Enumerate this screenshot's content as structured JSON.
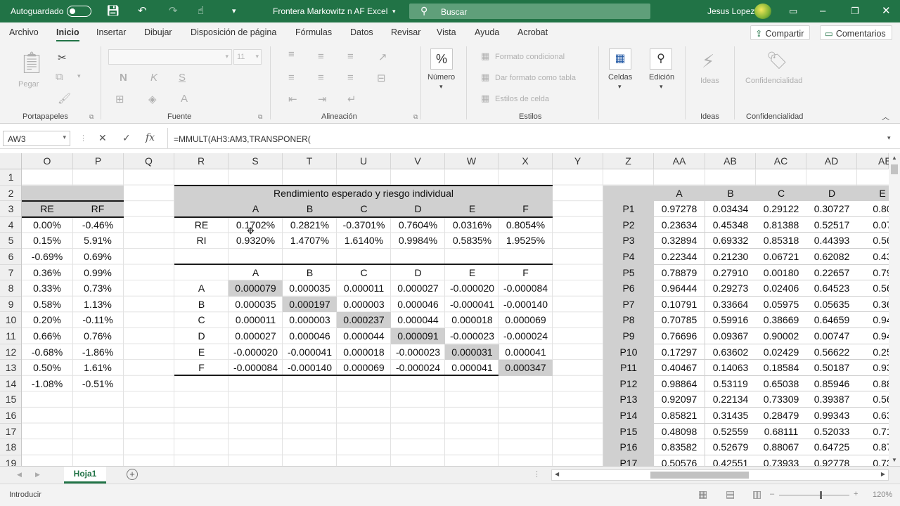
{
  "titlebar": {
    "autosave": "Autoguardado",
    "filename": "Frontera Markowitz n AF Excel",
    "search": "Buscar",
    "user": "Jesus Lopez"
  },
  "menu": {
    "items": [
      "Archivo",
      "Inicio",
      "Insertar",
      "Dibujar",
      "Disposición de página",
      "Fórmulas",
      "Datos",
      "Revisar",
      "Vista",
      "Ayuda",
      "Acrobat"
    ],
    "share": "Compartir",
    "comments": "Comentarios"
  },
  "ribbon": {
    "paste": "Pegar",
    "clipboard": "Portapapeles",
    "font_size": "11",
    "bold": "N",
    "italic": "K",
    "underline": "S",
    "font": "Fuente",
    "alignment": "Alineación",
    "number_sym": "%",
    "number": "Número",
    "cond_format": "Formato condicional",
    "table_format": "Dar formato como tabla",
    "cell_styles": "Estilos de celda",
    "styles": "Estilos",
    "cells": "Celdas",
    "editing": "Edición",
    "ideas": "Ideas",
    "ideas_group": "Ideas",
    "confidentiality": "Confidencialidad",
    "confidentiality_group": "Confidencialidad"
  },
  "formula_bar": {
    "name_box": "AW3",
    "formula": "=MMULT(AH3:AM3,TRANSPONER("
  },
  "columns": [
    "O",
    "P",
    "Q",
    "R",
    "S",
    "T",
    "U",
    "V",
    "W",
    "X",
    "Y",
    "Z",
    "AA",
    "AB",
    "AC",
    "AD",
    "AE"
  ],
  "rows": [
    "1",
    "2",
    "3",
    "4",
    "5",
    "6",
    "7",
    "8",
    "9",
    "10",
    "11",
    "12",
    "13",
    "14",
    "15",
    "16",
    "17",
    "18",
    "19"
  ],
  "left_table": {
    "headers": [
      "RE",
      "RF"
    ],
    "re": [
      "0.00%",
      "0.15%",
      "-0.69%",
      "0.36%",
      "0.33%",
      "0.58%",
      "0.20%",
      "0.66%",
      "-0.68%",
      "0.50%",
      "-1.08%"
    ],
    "rf": [
      "-0.46%",
      "5.91%",
      "0.69%",
      "0.99%",
      "0.73%",
      "1.13%",
      "-0.11%",
      "0.76%",
      "-1.86%",
      "1.61%",
      "-0.51%"
    ]
  },
  "risk_table": {
    "title": "Rendimiento esperado y riesgo individual",
    "assets": [
      "A",
      "B",
      "C",
      "D",
      "E",
      "F"
    ],
    "row_labels": [
      "RE",
      "RI"
    ],
    "re": [
      "0.1702%",
      "0.2821%",
      "-0.3701%",
      "0.7604%",
      "0.0316%",
      "0.8054%"
    ],
    "ri": [
      "0.9320%",
      "1.4707%",
      "1.6140%",
      "0.9984%",
      "0.5835%",
      "1.9525%"
    ]
  },
  "cov_matrix": {
    "assets": [
      "A",
      "B",
      "C",
      "D",
      "E",
      "F"
    ],
    "rows": [
      [
        "0.000079",
        "0.000035",
        "0.000011",
        "0.000027",
        "-0.000020",
        "-0.000084"
      ],
      [
        "0.000035",
        "0.000197",
        "0.000003",
        "0.000046",
        "-0.000041",
        "-0.000140"
      ],
      [
        "0.000011",
        "0.000003",
        "0.000237",
        "0.000044",
        "0.000018",
        "0.000069"
      ],
      [
        "0.000027",
        "0.000046",
        "0.000044",
        "0.000091",
        "-0.000023",
        "-0.000024"
      ],
      [
        "-0.000020",
        "-0.000041",
        "0.000018",
        "-0.000023",
        "0.000031",
        "0.000041"
      ],
      [
        "-0.000084",
        "-0.000140",
        "0.000069",
        "-0.000024",
        "0.000041",
        "0.000347"
      ]
    ]
  },
  "portfolio_table": {
    "headers": [
      "A",
      "B",
      "C",
      "D",
      "E"
    ],
    "labels": [
      "P1",
      "P2",
      "P3",
      "P4",
      "P5",
      "P6",
      "P7",
      "P8",
      "P9",
      "P10",
      "P11",
      "P12",
      "P13",
      "P14",
      "P15",
      "P16",
      "P17"
    ],
    "rows": [
      [
        "0.97278",
        "0.03434",
        "0.29122",
        "0.30727",
        "0.80"
      ],
      [
        "0.23634",
        "0.45348",
        "0.81388",
        "0.52517",
        "0.07"
      ],
      [
        "0.32894",
        "0.69332",
        "0.85318",
        "0.44393",
        "0.56"
      ],
      [
        "0.22344",
        "0.21230",
        "0.06721",
        "0.62082",
        "0.43"
      ],
      [
        "0.78879",
        "0.27910",
        "0.00180",
        "0.22657",
        "0.79"
      ],
      [
        "0.96444",
        "0.29273",
        "0.02406",
        "0.64523",
        "0.56"
      ],
      [
        "0.10791",
        "0.33664",
        "0.05975",
        "0.05635",
        "0.36"
      ],
      [
        "0.70785",
        "0.59916",
        "0.38669",
        "0.64659",
        "0.94"
      ],
      [
        "0.76696",
        "0.09367",
        "0.90002",
        "0.00747",
        "0.94"
      ],
      [
        "0.17297",
        "0.63602",
        "0.02429",
        "0.56622",
        "0.25"
      ],
      [
        "0.40467",
        "0.14063",
        "0.18584",
        "0.50187",
        "0.93"
      ],
      [
        "0.98864",
        "0.53119",
        "0.65038",
        "0.85946",
        "0.88"
      ],
      [
        "0.92097",
        "0.22134",
        "0.73309",
        "0.39387",
        "0.56"
      ],
      [
        "0.85821",
        "0.31435",
        "0.28479",
        "0.99343",
        "0.63"
      ],
      [
        "0.48098",
        "0.52559",
        "0.68111",
        "0.52033",
        "0.71"
      ],
      [
        "0.83582",
        "0.52679",
        "0.88067",
        "0.64725",
        "0.87"
      ],
      [
        "0.50576",
        "0.42551",
        "0.73933",
        "0.92778",
        "0.73"
      ]
    ]
  },
  "sheet": {
    "tab": "Hoja1",
    "add": "+"
  },
  "status": {
    "mode": "Introducir",
    "zoom": "120%"
  }
}
